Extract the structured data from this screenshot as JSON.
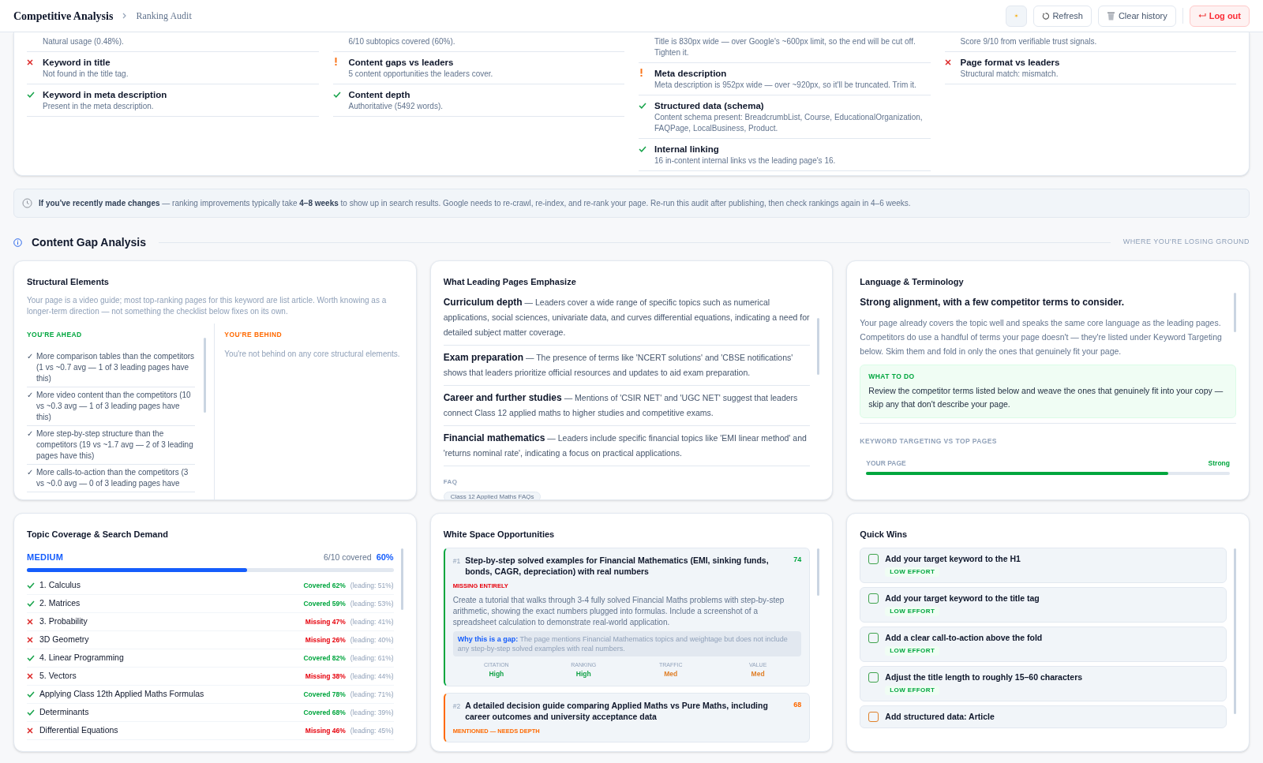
{
  "header": {
    "title": "Competitive Analysis",
    "crumb": "Ranking Audit",
    "buttons": [
      {
        "kind": "theme"
      },
      {
        "kind": "refresh",
        "label": "Refresh"
      },
      {
        "kind": "clear",
        "label": "Clear history"
      },
      {
        "kind": "logout",
        "label": "Log out"
      }
    ]
  },
  "checks": [
    [
      {
        "desc": "Natural usage (0.48%)."
      },
      {
        "kind": "fail",
        "title": "Keyword in title",
        "desc": "Not found in the title tag."
      },
      {
        "kind": "pass",
        "title": "Keyword in meta description",
        "desc": "Present in the meta description."
      }
    ],
    [
      {
        "desc": "6/10 subtopics covered (60%)."
      },
      {
        "kind": "warn",
        "title": "Content gaps vs leaders",
        "desc": "5 content opportunities the leaders cover."
      },
      {
        "kind": "pass",
        "title": "Content depth",
        "desc": "Authoritative (5492 words)."
      }
    ],
    [
      {
        "desc": "Title is 830px wide — over Google's ~600px limit, so the end will be cut off. Tighten it."
      },
      {
        "kind": "warn",
        "title": "Meta description",
        "desc": "Meta description is 952px wide — over ~920px, so it'll be truncated. Trim it."
      },
      {
        "kind": "pass",
        "title": "Structured data (schema)",
        "desc": "Content schema present: BreadcrumbList, Course, EducationalOrganization, FAQPage, LocalBusiness, Product."
      },
      {
        "kind": "pass",
        "title": "Internal linking",
        "desc": "16 in-content internal links vs the leading page's 16."
      }
    ],
    [
      {
        "desc": "Score 9/10 from verifiable trust signals."
      },
      {
        "kind": "fail",
        "title": "Page format vs leaders",
        "desc": "Structural match: mismatch."
      }
    ]
  ],
  "notice": {
    "text": "**If you've recently made changes** — ranking improvements typically take **4–8 weeks** to show up in search results. Google needs to re-crawl, re-index, and re-rank your page. Re-run this audit after publishing, then check rankings again in 4–6 weeks."
  },
  "section": {
    "title": "Content Gap Analysis",
    "aside": "WHERE YOU'RE LOSING GROUND"
  },
  "structural": {
    "title": "Structural Elements",
    "intro": "Your page is a video guide; most top-ranking pages for this keyword are list article. Worth knowing as a longer-term direction — not something the checklist below fixes on its own.",
    "ahead_label": "YOU'RE AHEAD",
    "behind_label": "YOU'RE BEHIND",
    "ahead": [
      {
        "mark": "✓",
        "text": "More comparison tables than the competitors (1 vs ~0.7 avg — 1 of 3 leading pages have this)"
      },
      {
        "mark": "✓",
        "text": "More video content than the competitors (10 vs ~0.3 avg — 1 of 3 leading pages have this)"
      },
      {
        "mark": "✓",
        "text": "More step-by-step structure than the competitors (19 vs ~1.7 avg — 2 of 3 leading pages have this)"
      },
      {
        "mark": "✓",
        "text": "More calls-to-action than the competitors (3 vs ~0.0 avg — 0 of 3 leading pages have"
      }
    ],
    "behind_empty": "You're not behind on any core structural elements."
  },
  "emphasize": {
    "title": "What Leading Pages Emphasize",
    "items": [
      {
        "topic": "Curriculum depth",
        "text": "— Leaders cover a wide range of specific topics such as numerical applications, social sciences, univariate data, and curves differential equations, indicating a need for detailed subject matter coverage."
      },
      {
        "topic": "Exam preparation",
        "text": "— The presence of terms like 'NCERT solutions' and 'CBSE notifications' shows that leaders prioritize official resources and updates to aid exam preparation."
      },
      {
        "topic": "Career and further studies",
        "text": "— Mentions of 'CSIR NET' and 'UGC NET' suggest that leaders connect Class 12 applied maths to higher studies and competitive exams."
      },
      {
        "topic": "Financial mathematics",
        "text": "— Leaders include specific financial topics like 'EMI linear method' and 'returns nominal rate', indicating a focus on practical applications."
      }
    ],
    "faq_label": "FAQ",
    "faq_chips": [
      "Class 12 Applied Maths FAQs"
    ]
  },
  "language": {
    "title": "Language & Terminology",
    "headline": "Strong alignment, with a few competitor terms to consider.",
    "body": "Your page already covers the topic well and speaks the same core language as the leading pages. Competitors do use a handful of terms your page doesn't — they're listed under Keyword Targeting below. Skim them and fold in only the ones that genuinely fit your page.",
    "todo_label": "WHAT TO DO",
    "todo": "Review the competitor terms listed below and weave the ones that genuinely fit into your copy — skip any that don't describe your page.",
    "targeting_label": "KEYWORD TARGETING VS TOP PAGES",
    "meter": {
      "label": "YOUR PAGE",
      "reading": "Strong",
      "level": 0.83
    }
  },
  "coverage": {
    "title": "Topic Coverage & Search Demand",
    "demand": "MEDIUM",
    "covered": "6/10 covered",
    "percent": "60%",
    "level": 0.6,
    "topics": [
      {
        "kind": "covered",
        "name": "1. Calculus",
        "result": "Covered 62%",
        "leading": "(leading: 51%)"
      },
      {
        "kind": "covered",
        "name": "2. Matrices",
        "result": "Covered 59%",
        "leading": "(leading: 53%)"
      },
      {
        "kind": "missing",
        "name": "3. Probability",
        "result": "Missing 47%",
        "leading": "(leading: 41%)"
      },
      {
        "kind": "missing",
        "name": "3D Geometry",
        "result": "Missing 26%",
        "leading": "(leading: 40%)"
      },
      {
        "kind": "covered",
        "name": "4. Linear Programming",
        "result": "Covered 82%",
        "leading": "(leading: 61%)"
      },
      {
        "kind": "missing",
        "name": "5. Vectors",
        "result": "Missing 38%",
        "leading": "(leading: 44%)"
      },
      {
        "kind": "covered",
        "name": "Applying Class 12th Applied Maths Formulas",
        "result": "Covered 78%",
        "leading": "(leading: 71%)"
      },
      {
        "kind": "covered",
        "name": "Determinants",
        "result": "Covered 68%",
        "leading": "(leading: 39%)"
      },
      {
        "kind": "missing",
        "name": "Differential Equations",
        "result": "Missing 46%",
        "leading": "(leading: 45%)"
      }
    ]
  },
  "whitespace": {
    "title": "White Space Opportunities",
    "items": [
      {
        "kind": "missing",
        "rank": "#1",
        "title": "Step-by-step solved examples for Financial Mathematics (EMI, sinking funds, bonds, CAGR, depreciation) with real numbers",
        "score": "74",
        "tag": "MISSING ENTIRELY",
        "desc": "Create a tutorial that walks through 3-4 fully solved Financial Maths problems with step-by-step arithmetic, showing the exact numbers plugged into formulas. Include a screenshot of a spreadsheet calculation to demonstrate real-world application.",
        "gap_label": "Why this is a gap:",
        "gap_text": "The page mentions Financial Mathematics topics and weightage but does not include any step-by-step solved examples with real numbers.",
        "metrics": [
          {
            "label": "CITATION",
            "value": "High",
            "color": "#16a34a"
          },
          {
            "label": "RANKING",
            "value": "High",
            "color": "#16a34a"
          },
          {
            "label": "TRAFFIC",
            "value": "Med",
            "color": "#e0812b"
          },
          {
            "label": "VALUE",
            "value": "Med",
            "color": "#e0812b"
          }
        ]
      },
      {
        "kind": "mentioned",
        "rank": "#2",
        "title": "A detailed decision guide comparing Applied Maths vs Pure Maths, including career outcomes and university acceptance data",
        "score": "68",
        "tag": "MENTIONED — NEEDS DEPTH"
      }
    ]
  },
  "quickwins": {
    "title": "Quick Wins",
    "items": [
      {
        "text": "Add your target keyword to the H1",
        "effort": "LOW EFFORT",
        "checked": false,
        "color": "#3fa34d"
      },
      {
        "text": "Add your target keyword to the title tag",
        "effort": "LOW EFFORT",
        "checked": false,
        "color": "#3fa34d"
      },
      {
        "text": "Add a clear call-to-action above the fold",
        "effort": "LOW EFFORT",
        "checked": false,
        "color": "#3fa34d"
      },
      {
        "text": "Adjust the title length to roughly 15–60 characters",
        "effort": "LOW EFFORT",
        "checked": false,
        "color": "#3fa34d"
      },
      {
        "text": "Add structured data: Article",
        "checked": false,
        "color": "#e0812b"
      }
    ]
  }
}
